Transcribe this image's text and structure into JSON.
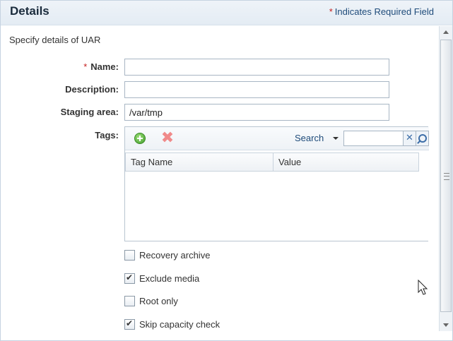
{
  "header": {
    "title": "Details",
    "required_star": "*",
    "required_text": "Indicates Required Field"
  },
  "subtitle": "Specify details of UAR",
  "form": {
    "name": {
      "required_star": "*",
      "label": "Name:",
      "value": ""
    },
    "description": {
      "label": "Description:",
      "value": ""
    },
    "staging_area": {
      "label": "Staging area:",
      "value": "/var/tmp"
    },
    "tags": {
      "label": "Tags:",
      "toolbar": {
        "add_icon": "add-circle-icon",
        "delete_icon": "delete-x-icon",
        "delete_glyph": "✖",
        "search_label": "Search",
        "search_value": "",
        "clear_glyph": "✕"
      },
      "columns": [
        "Tag Name",
        "Value"
      ],
      "rows": []
    },
    "checkboxes": [
      {
        "label": "Recovery archive",
        "checked": false
      },
      {
        "label": "Exclude media",
        "checked": true
      },
      {
        "label": "Root only",
        "checked": false
      },
      {
        "label": "Skip capacity check",
        "checked": true
      }
    ]
  },
  "colors": {
    "required": "#c41e1e",
    "link": "#1e4b7a",
    "header_bg": "#e4ecf4"
  }
}
